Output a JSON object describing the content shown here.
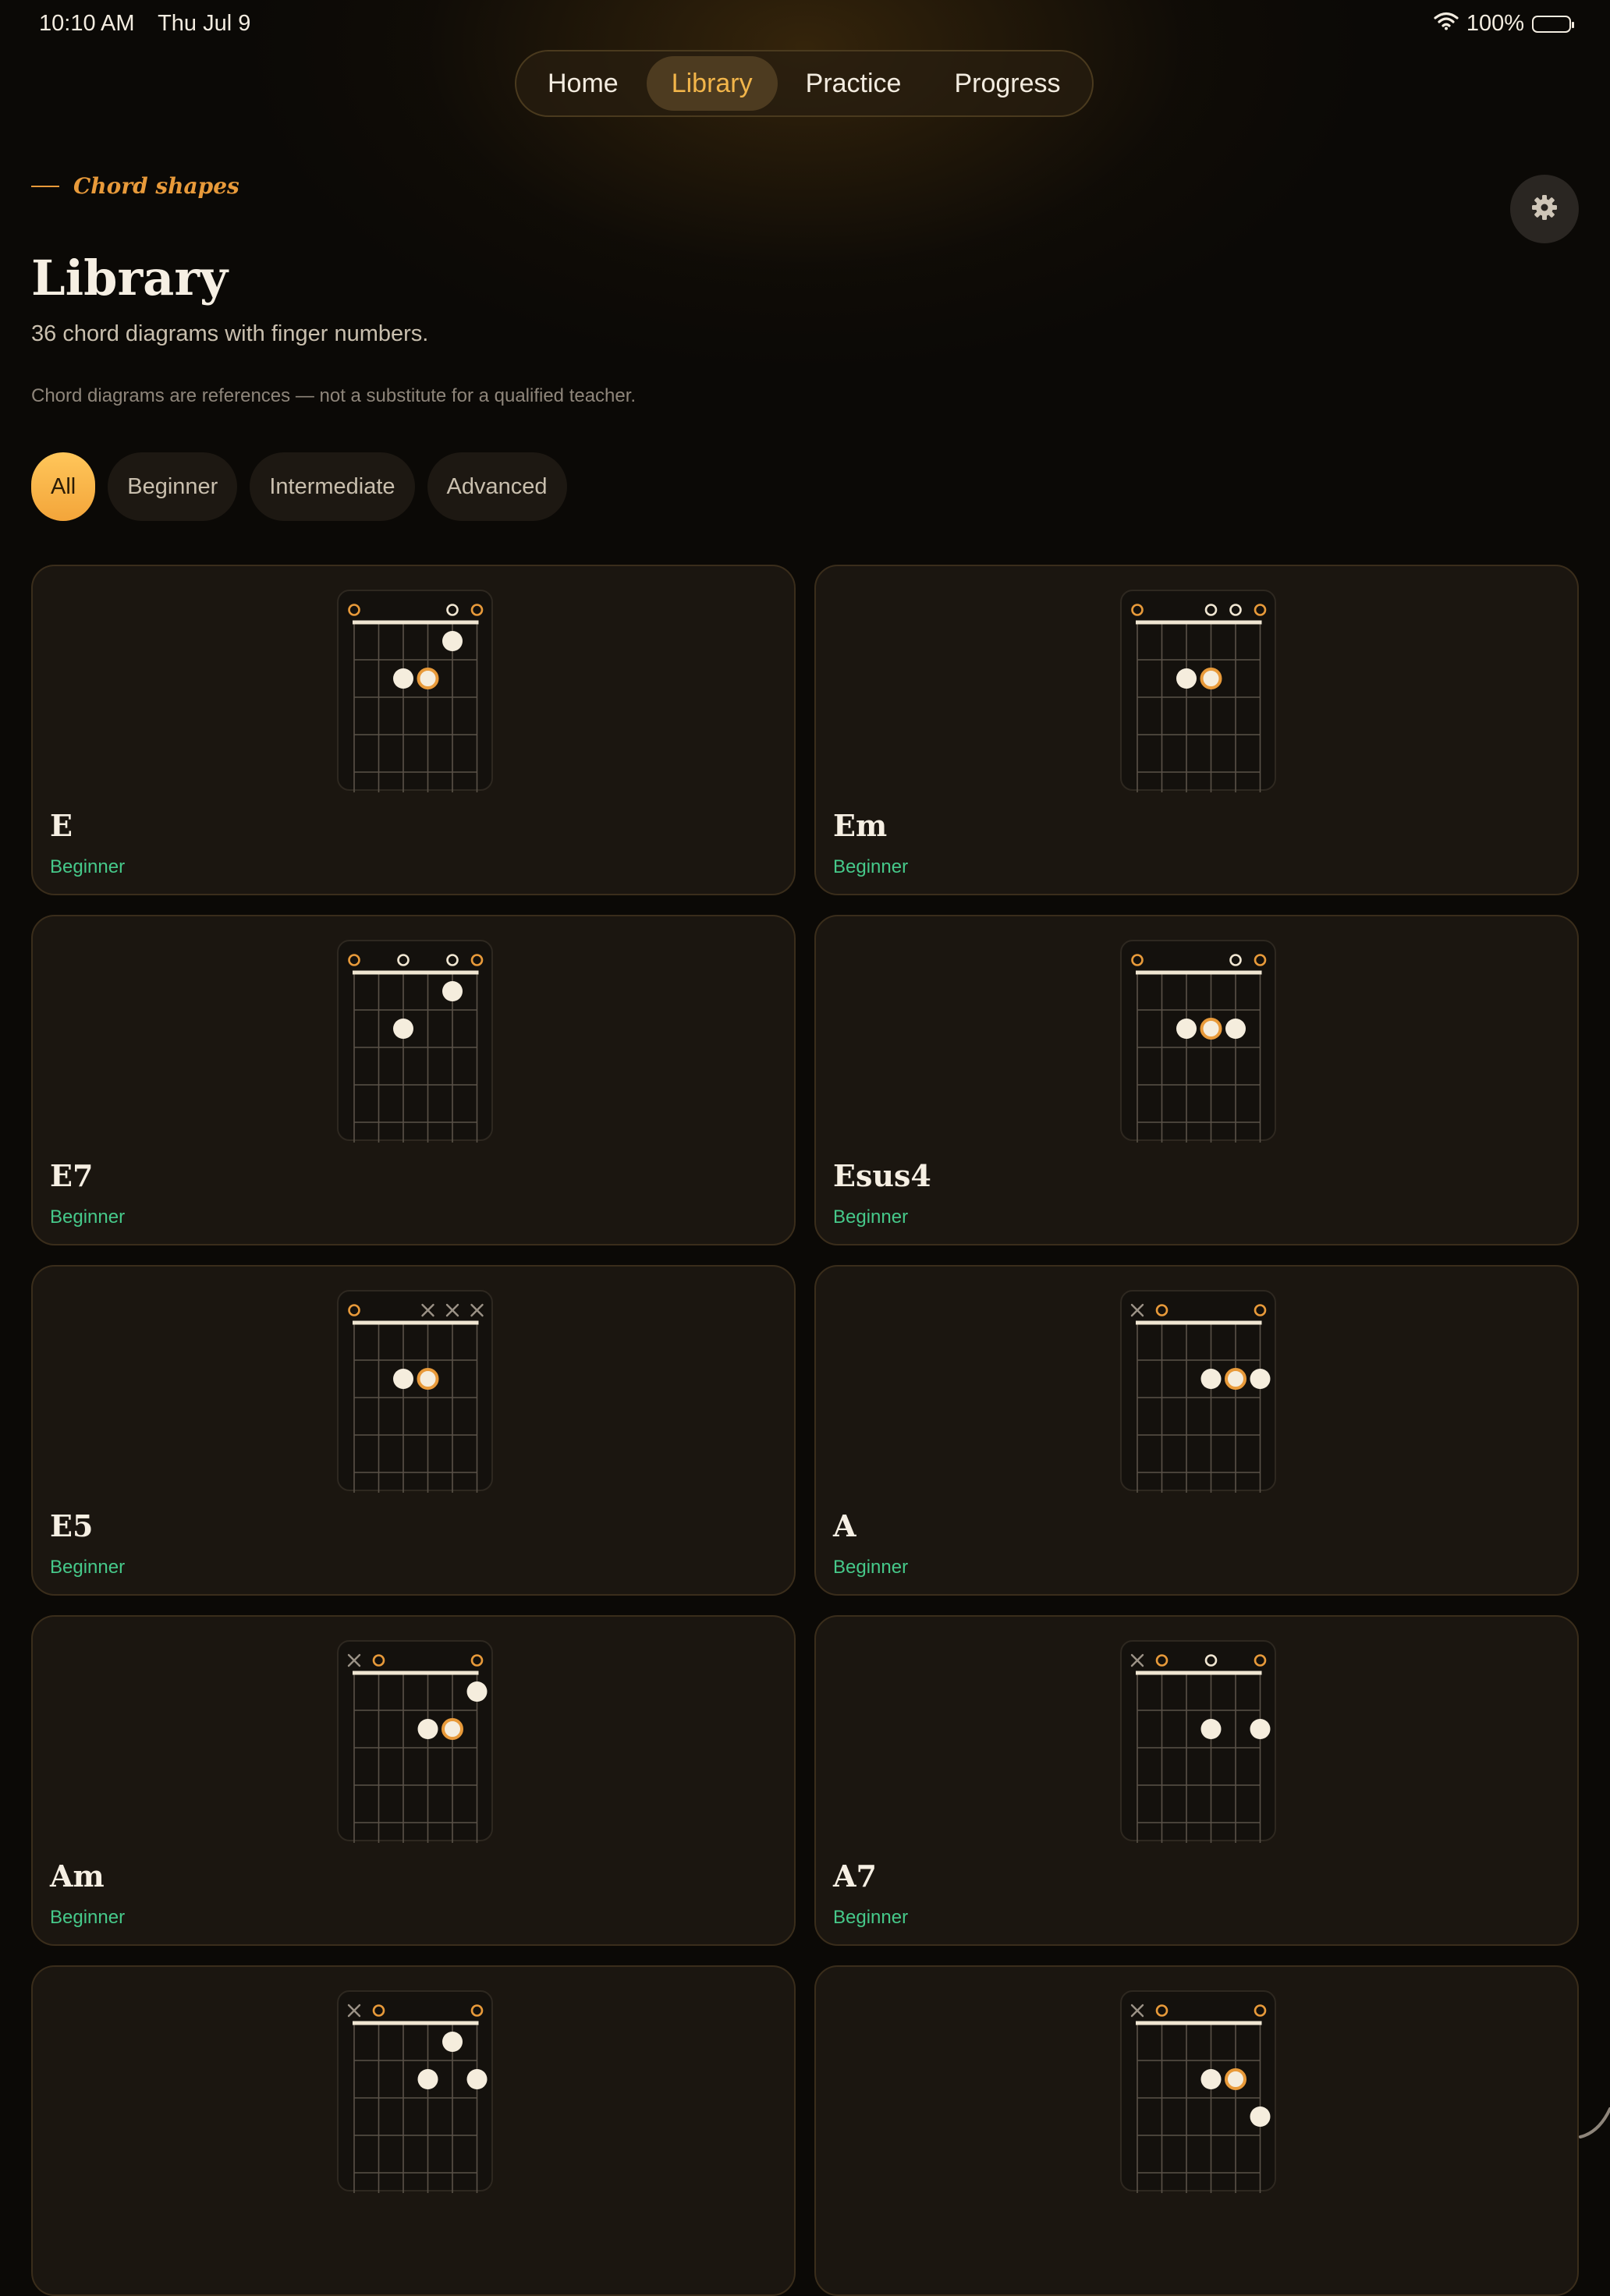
{
  "status": {
    "time": "10:10 AM",
    "date": "Thu Jul 9",
    "battery": "100%"
  },
  "nav": {
    "items": [
      {
        "label": "Home",
        "active": false
      },
      {
        "label": "Library",
        "active": true
      },
      {
        "label": "Practice",
        "active": false
      },
      {
        "label": "Progress",
        "active": false
      }
    ]
  },
  "header": {
    "eyebrow": "Chord shapes",
    "title": "Library",
    "subtitle": "36 chord diagrams with finger numbers.",
    "disclaimer": "Chord diagrams are references — not a substitute for a qualified teacher."
  },
  "filters": [
    {
      "label": "All",
      "active": true
    },
    {
      "label": "Beginner",
      "active": false
    },
    {
      "label": "Intermediate",
      "active": false
    },
    {
      "label": "Advanced",
      "active": false
    }
  ],
  "colors": {
    "accent": "#f2b54a",
    "orange": "#e89a3a",
    "level_green": "#46c98a",
    "dot": "#f5eddd"
  },
  "chords": [
    {
      "name": "E",
      "level": "Beginner",
      "markers": [
        "o",
        "",
        "",
        "",
        "o",
        "o"
      ],
      "dots": [
        [
          2,
          2,
          "w"
        ],
        [
          3,
          2,
          "r"
        ],
        [
          4,
          1,
          "w"
        ]
      ]
    },
    {
      "name": "Em",
      "level": "Beginner",
      "markers": [
        "o",
        "",
        "",
        "o",
        "o",
        "o"
      ],
      "dots": [
        [
          2,
          2,
          "w"
        ],
        [
          3,
          2,
          "r"
        ]
      ]
    },
    {
      "name": "E7",
      "level": "Beginner",
      "markers": [
        "o",
        "",
        "o",
        "",
        "o",
        "o"
      ],
      "dots": [
        [
          2,
          2,
          "w"
        ],
        [
          4,
          1,
          "w"
        ]
      ]
    },
    {
      "name": "Esus4",
      "level": "Beginner",
      "markers": [
        "o",
        "",
        "",
        "",
        "o",
        "o"
      ],
      "dots": [
        [
          2,
          2,
          "w"
        ],
        [
          3,
          2,
          "r"
        ],
        [
          4,
          2,
          "w"
        ]
      ]
    },
    {
      "name": "E5",
      "level": "Beginner",
      "markers": [
        "o",
        "",
        "",
        "x",
        "x",
        "x"
      ],
      "dots": [
        [
          2,
          2,
          "w"
        ],
        [
          3,
          2,
          "r"
        ]
      ]
    },
    {
      "name": "A",
      "level": "Beginner",
      "markers": [
        "x",
        "o",
        "",
        "",
        "",
        "o"
      ],
      "dots": [
        [
          3,
          2,
          "w"
        ],
        [
          4,
          2,
          "r"
        ],
        [
          5,
          2,
          "w"
        ]
      ]
    },
    {
      "name": "Am",
      "level": "Beginner",
      "markers": [
        "x",
        "o",
        "",
        "",
        "",
        "o"
      ],
      "dots": [
        [
          3,
          2,
          "w"
        ],
        [
          4,
          2,
          "r"
        ],
        [
          5,
          1,
          "w"
        ]
      ]
    },
    {
      "name": "A7",
      "level": "Beginner",
      "markers": [
        "x",
        "o",
        "",
        "o",
        "",
        "o"
      ],
      "dots": [
        [
          3,
          2,
          "w"
        ],
        [
          5,
          2,
          "w"
        ]
      ]
    },
    {
      "name": "",
      "level": "",
      "markers": [
        "x",
        "o",
        "",
        "",
        "",
        "o"
      ],
      "dots": [
        [
          3,
          2,
          "w"
        ],
        [
          4,
          1,
          "w"
        ],
        [
          5,
          2,
          "w"
        ]
      ]
    },
    {
      "name": "",
      "level": "",
      "markers": [
        "x",
        "o",
        "",
        "",
        "",
        "o"
      ],
      "dots": [
        [
          3,
          2,
          "w"
        ],
        [
          4,
          2,
          "r"
        ],
        [
          5,
          3,
          "w"
        ]
      ]
    }
  ]
}
